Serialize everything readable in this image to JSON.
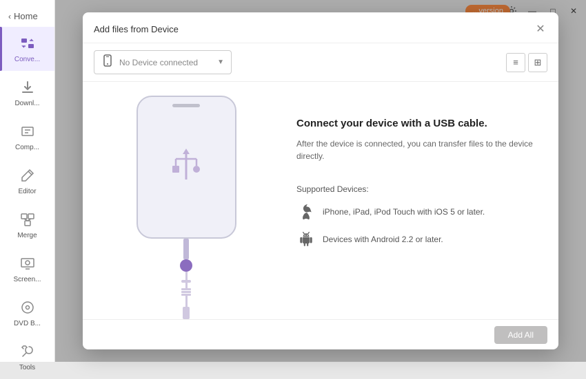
{
  "app": {
    "title": "Home",
    "window_controls": {
      "minimize": "—",
      "maximize": "□",
      "close": "✕"
    }
  },
  "topbar": {
    "notification_icon": "🔔",
    "settings_icon": "⚙"
  },
  "sidebar": {
    "back_label": "Home",
    "items": [
      {
        "id": "convert",
        "label": "Conve...",
        "icon": "▶",
        "active": true
      },
      {
        "id": "download",
        "label": "Downl...",
        "icon": "⬇",
        "active": false
      },
      {
        "id": "compress",
        "label": "Comp...",
        "icon": "🗜",
        "active": false
      },
      {
        "id": "editor",
        "label": "Editor",
        "icon": "✂",
        "active": false
      },
      {
        "id": "merge",
        "label": "Merge",
        "icon": "⊞",
        "active": false
      },
      {
        "id": "screen",
        "label": "Screen...",
        "icon": "📷",
        "active": false
      },
      {
        "id": "dvd",
        "label": "DVD B...",
        "icon": "💿",
        "active": false
      },
      {
        "id": "tools",
        "label": "Tools",
        "icon": "🔧",
        "active": false
      }
    ]
  },
  "modal": {
    "title": "Add files from Device",
    "close_icon": "✕",
    "device_selector": {
      "icon": "📱",
      "text": "No Device connected",
      "arrow": "▼"
    },
    "view_list_icon": "≡",
    "view_grid_icon": "⊞",
    "connect": {
      "title": "Connect your device with a USB cable.",
      "description": "After the device is connected, you can transfer files to the device directly."
    },
    "supported": {
      "label": "Supported Devices:",
      "devices": [
        {
          "id": "apple",
          "icon": "apple",
          "text": "iPhone, iPad, iPod Touch with iOS 5 or later."
        },
        {
          "id": "android",
          "icon": "android",
          "text": "Devices with Android 2.2 or later."
        }
      ]
    },
    "footer": {
      "add_all_label": "Add All"
    }
  },
  "upgrade": {
    "label": "...version"
  }
}
